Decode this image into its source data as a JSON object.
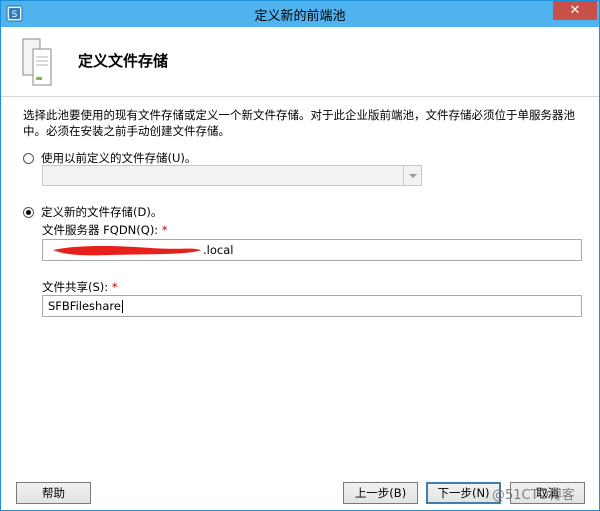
{
  "window": {
    "title": "定义新的前端池",
    "close_label": "✕"
  },
  "header": {
    "title": "定义文件存储"
  },
  "description": "选择此池要使用的现有文件存储或定义一个新文件存储。对于此企业版前端池，文件存储必须位于单服务器池中。必须在安装之前手动创建文件存储。",
  "options": {
    "use_existing": {
      "label": "使用以前定义的文件存储(U)。",
      "selected": false
    },
    "define_new": {
      "label": "定义新的文件存储(D)。",
      "selected": true
    }
  },
  "existing_combo": {
    "value": ""
  },
  "fqdn": {
    "label": "文件服务器 FQDN(Q):",
    "required_mark": "*",
    "value_suffix": ".local"
  },
  "share": {
    "label": "文件共享(S):",
    "required_mark": "*",
    "value": "SFBFileshare"
  },
  "buttons": {
    "help": "帮助",
    "back": "上一步(B)",
    "next": "下一步(N)",
    "cancel": "取消"
  },
  "watermark": "@51CTO博客",
  "colors": {
    "titlebar": "#4fb3f0",
    "close": "#c7504a",
    "required": "#c00000",
    "redaction": "#e8201c"
  }
}
